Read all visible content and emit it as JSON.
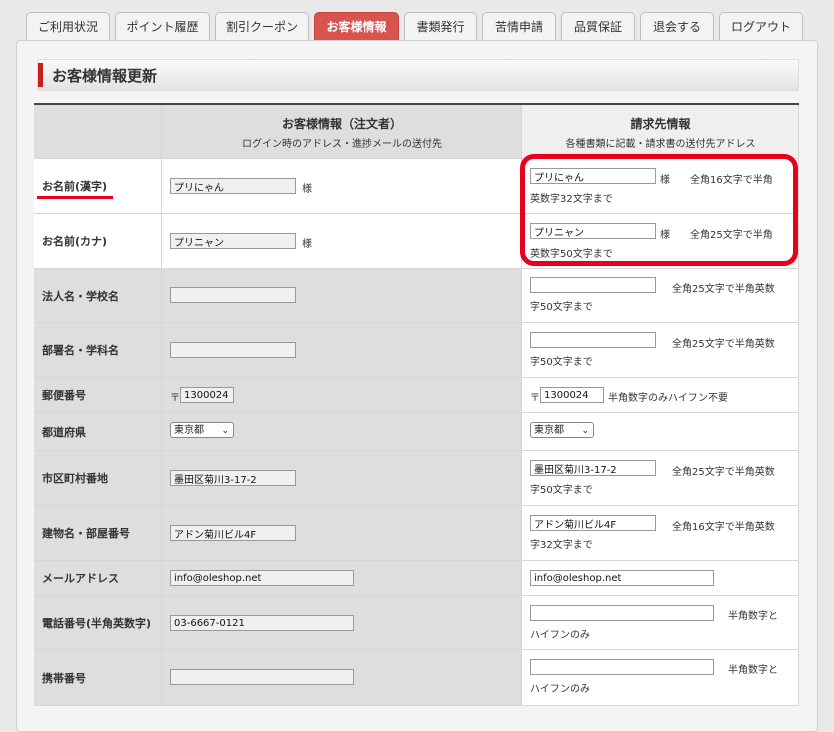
{
  "tabs": [
    {
      "label": "ご利用状況",
      "active": false
    },
    {
      "label": "ポイント履歴",
      "active": false
    },
    {
      "label": "割引クーポン",
      "active": false
    },
    {
      "label": "お客様情報",
      "active": true
    },
    {
      "label": "書類発行",
      "active": false
    },
    {
      "label": "苦情申請",
      "active": false
    },
    {
      "label": "品質保証",
      "active": false
    },
    {
      "label": "退会する",
      "active": false
    },
    {
      "label": "ログアウト",
      "active": false
    }
  ],
  "section_title": "お客様情報更新",
  "header": {
    "customer_title": "お客様情報（注文者）",
    "customer_sub": "ログイン時のアドレス・進捗メールの送付先",
    "billing_title": "請求先情報",
    "billing_sub": "各種書類に記載・請求書の送付先アドレス"
  },
  "rows": {
    "name_kanji": {
      "label": "お名前(漢字)",
      "customer": "プリにゃん",
      "suffix": "様",
      "billing": "プリにゃん",
      "note1": "全角16文字で半角",
      "note2": "英数字32文字まで"
    },
    "name_kana": {
      "label": "お名前(カナ)",
      "customer": "プリニャン",
      "suffix": "様",
      "billing": "プリニャン",
      "note1": "全角25文字で半角",
      "note2": "英数字50文字まで"
    },
    "company": {
      "label": "法人名・学校名",
      "customer": "",
      "billing": "",
      "note1": "全角25文字で半角英数",
      "note2": "字50文字まで"
    },
    "department": {
      "label": "部署名・学科名",
      "customer": "",
      "billing": "",
      "note1": "全角25文字で半角英数",
      "note2": "字50文字まで"
    },
    "zip": {
      "label": "郵便番号",
      "mark": "〒",
      "customer": "1300024",
      "billing": "1300024",
      "note1": "半角数字のみハイフン不要"
    },
    "prefecture": {
      "label": "都道府県",
      "customer": "東京都",
      "billing": "東京都"
    },
    "city": {
      "label": "市区町村番地",
      "customer": "墨田区菊川3-17-2",
      "billing": "墨田区菊川3-17-2",
      "note1": "全角25文字で半角英数",
      "note2": "字50文字まで"
    },
    "building": {
      "label": "建物名・部屋番号",
      "customer": "アドン菊川ビル4F",
      "billing": "アドン菊川ビル4F",
      "note1": "全角16文字で半角英数",
      "note2": "字32文字まで"
    },
    "email": {
      "label": "メールアドレス",
      "customer": "info@oleshop.net",
      "billing": "info@oleshop.net"
    },
    "phone": {
      "label": "電話番号(半角英数字)",
      "customer": "03-6667-0121",
      "billing": "",
      "note1": "半角数字と",
      "note2": "ハイフンのみ"
    },
    "mobile": {
      "label": "携帯番号",
      "customer": "",
      "billing": "",
      "note1": "半角数字と",
      "note2": "ハイフンのみ"
    }
  },
  "colors": {
    "active_tab": "#d9534f",
    "highlight": "#e6001b"
  },
  "icons": {
    "caret": "chevron-down-icon"
  }
}
